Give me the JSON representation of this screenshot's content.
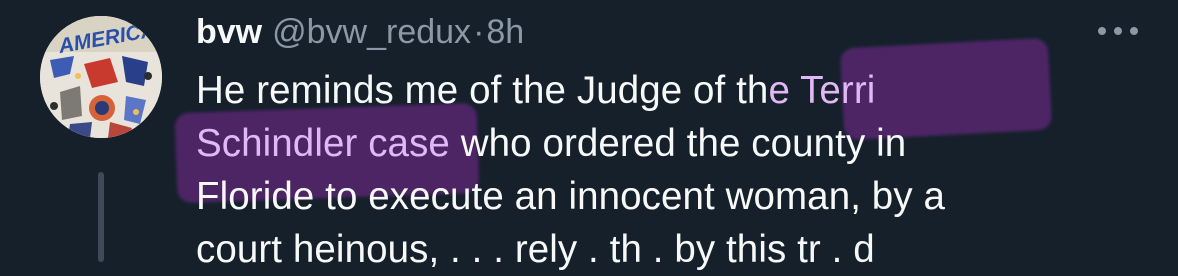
{
  "tweet": {
    "display_name": "bvw",
    "handle": "@bvw_redux",
    "separator": "·",
    "time": "8h",
    "more_icon": "more-horizontal-icon",
    "text_lines": [
      {
        "pre": "He reminds me of the Judge of th",
        "hl": "e Terri",
        "post": ""
      },
      {
        "pre": "",
        "hl": "Schindler case",
        "post": " who ordered the county in"
      },
      {
        "pre": "Floride to execute an innocent woman, by a",
        "hl": "",
        "post": ""
      },
      {
        "pre": "court heinous, . . . rely  . th . by this tr . d",
        "hl": "",
        "post": ""
      }
    ],
    "avatar_text": "AMERICA"
  },
  "colors": {
    "background": "#15202b",
    "text": "#f7f9f9",
    "secondary": "#8b98a5",
    "highlight": "#7b2a96"
  }
}
